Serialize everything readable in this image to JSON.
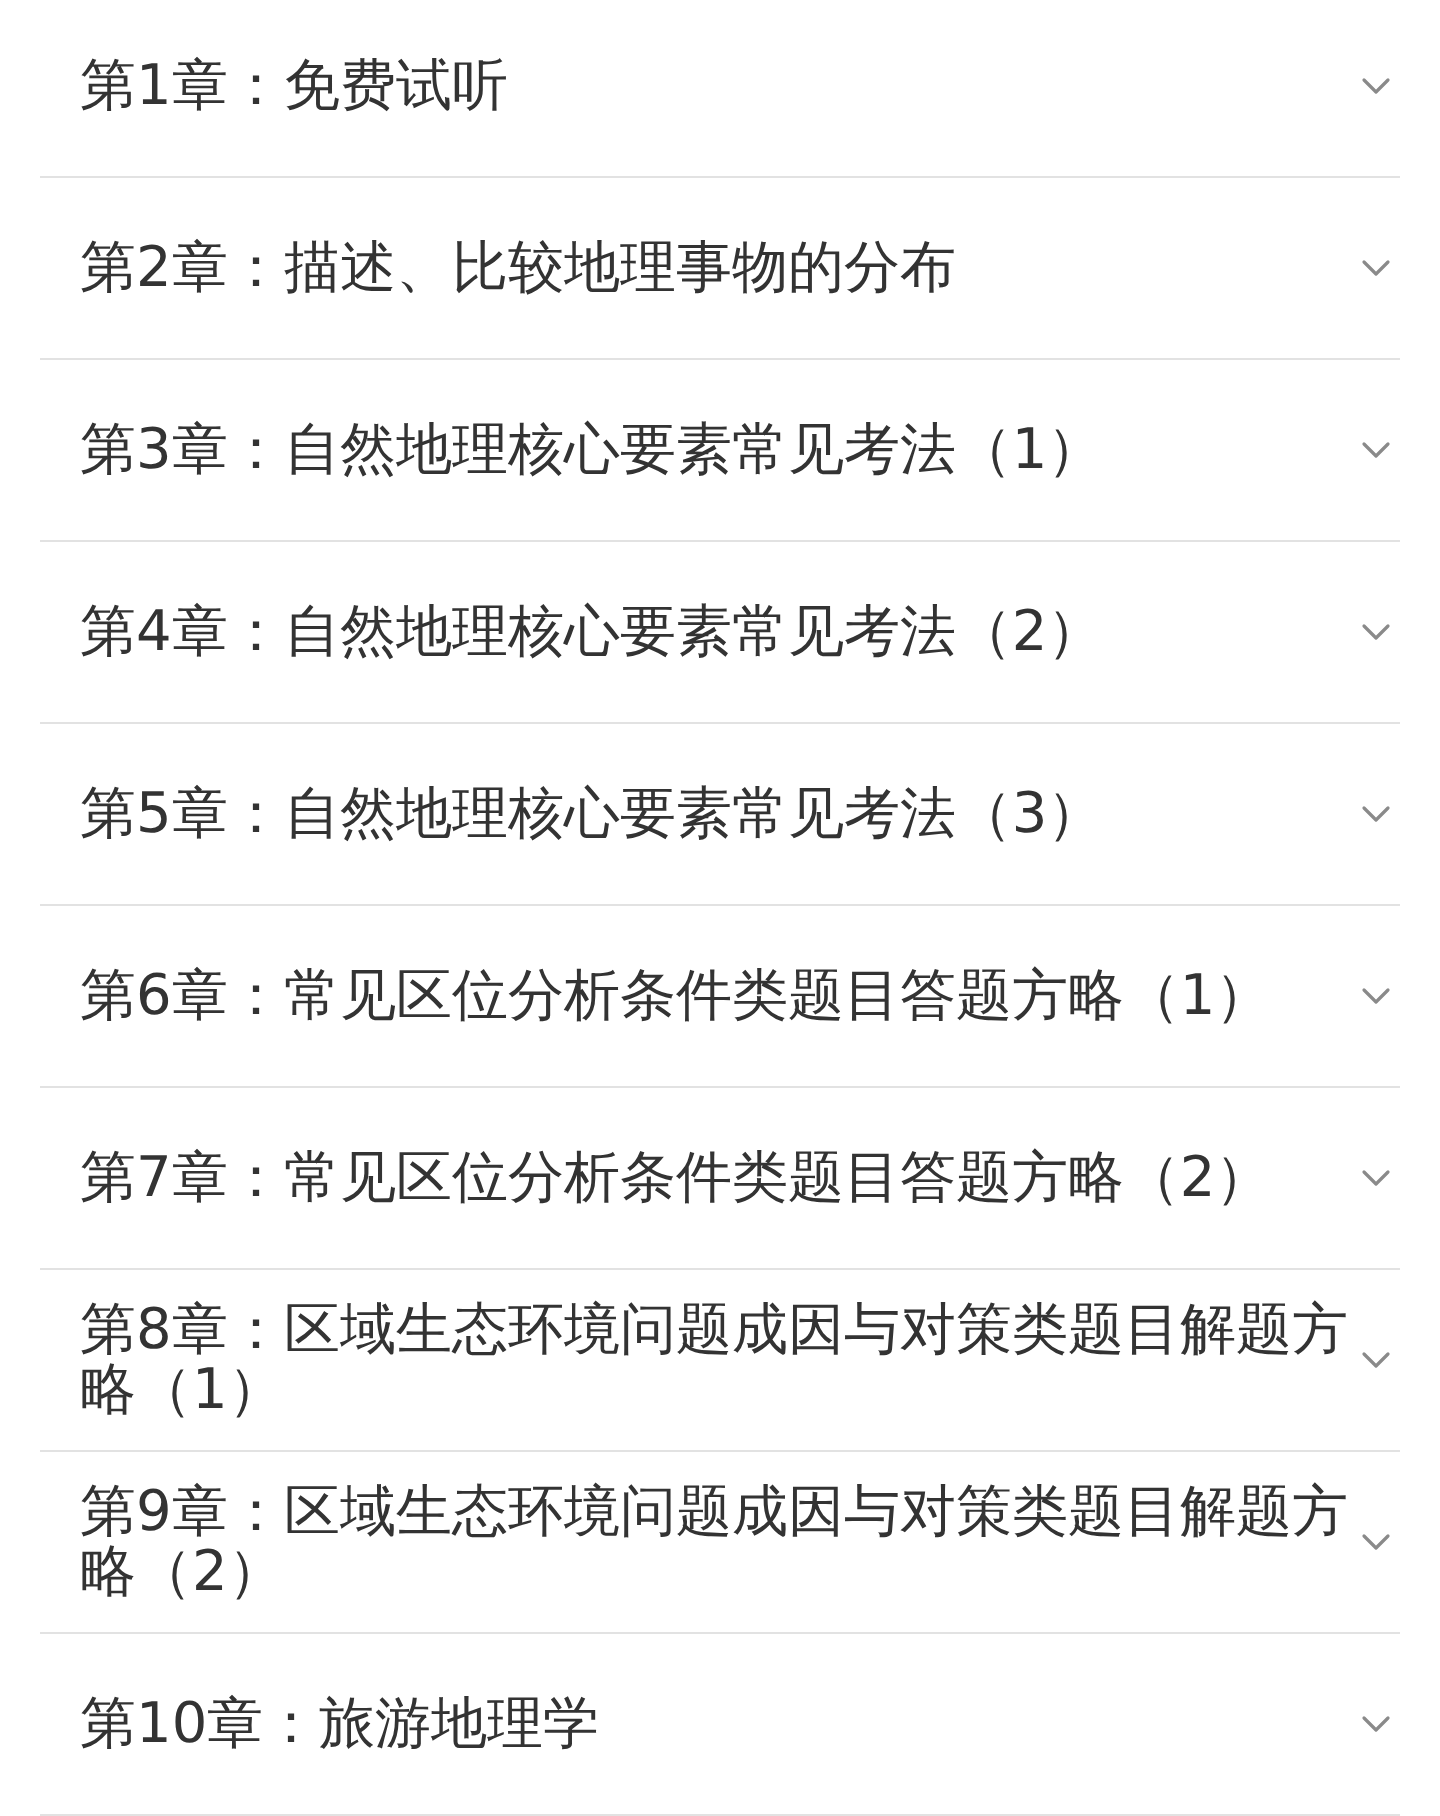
{
  "chapters": [
    {
      "title": "第1章：免费试听",
      "expanded": false
    },
    {
      "title": "第2章：描述、比较地理事物的分布",
      "expanded": false
    },
    {
      "title": "第3章：自然地理核心要素常见考法（1）",
      "expanded": false
    },
    {
      "title": "第4章：自然地理核心要素常见考法（2）",
      "expanded": false
    },
    {
      "title": "第5章：自然地理核心要素常见考法（3）",
      "expanded": false
    },
    {
      "title": "第6章：常见区位分析条件类题目答题方略（1）",
      "expanded": false
    },
    {
      "title": "第7章：常见区位分析条件类题目答题方略（2）",
      "expanded": false
    },
    {
      "title": "第8章：区域生态环境问题成因与对策类题目解题方略（1）",
      "expanded": false
    },
    {
      "title": "第9章：区域生态环境问题成因与对策类题目解题方略（2）",
      "expanded": false
    },
    {
      "title": "第10章：旅游地理学",
      "expanded": false
    }
  ]
}
